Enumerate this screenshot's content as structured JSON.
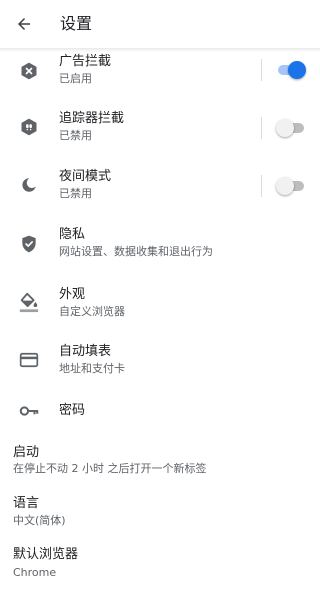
{
  "header": {
    "title": "设置",
    "back_icon": "arrow-back-icon"
  },
  "colors": {
    "accent": "#1a73e8",
    "icon": "#5f6368",
    "text": "#202124",
    "subtext": "#5f6368"
  },
  "items": [
    {
      "icon": "ad-block-icon",
      "title": "广告拦截",
      "subtitle": "已启用",
      "toggle": true
    },
    {
      "icon": "tracker-block-icon",
      "title": "追踪器拦截",
      "subtitle": "已禁用",
      "toggle": false
    },
    {
      "icon": "night-mode-icon",
      "title": "夜间模式",
      "subtitle": "已禁用",
      "toggle": false
    },
    {
      "icon": "privacy-shield-icon",
      "title": "隐私",
      "subtitle": "网站设置、数据收集和退出行为"
    },
    {
      "icon": "paint-bucket-icon",
      "title": "外观",
      "subtitle": "自定义浏览器"
    },
    {
      "icon": "credit-card-icon",
      "title": "自动填表",
      "subtitle": "地址和支付卡"
    },
    {
      "icon": "key-icon",
      "title": "密码"
    }
  ],
  "plain_items": [
    {
      "title": "启动",
      "subtitle": "在停止不动 2 小时 之后打开一个新标签"
    },
    {
      "title": "语言",
      "subtitle": "中文(简体)"
    },
    {
      "title": "默认浏览器",
      "subtitle": "Chrome"
    }
  ]
}
